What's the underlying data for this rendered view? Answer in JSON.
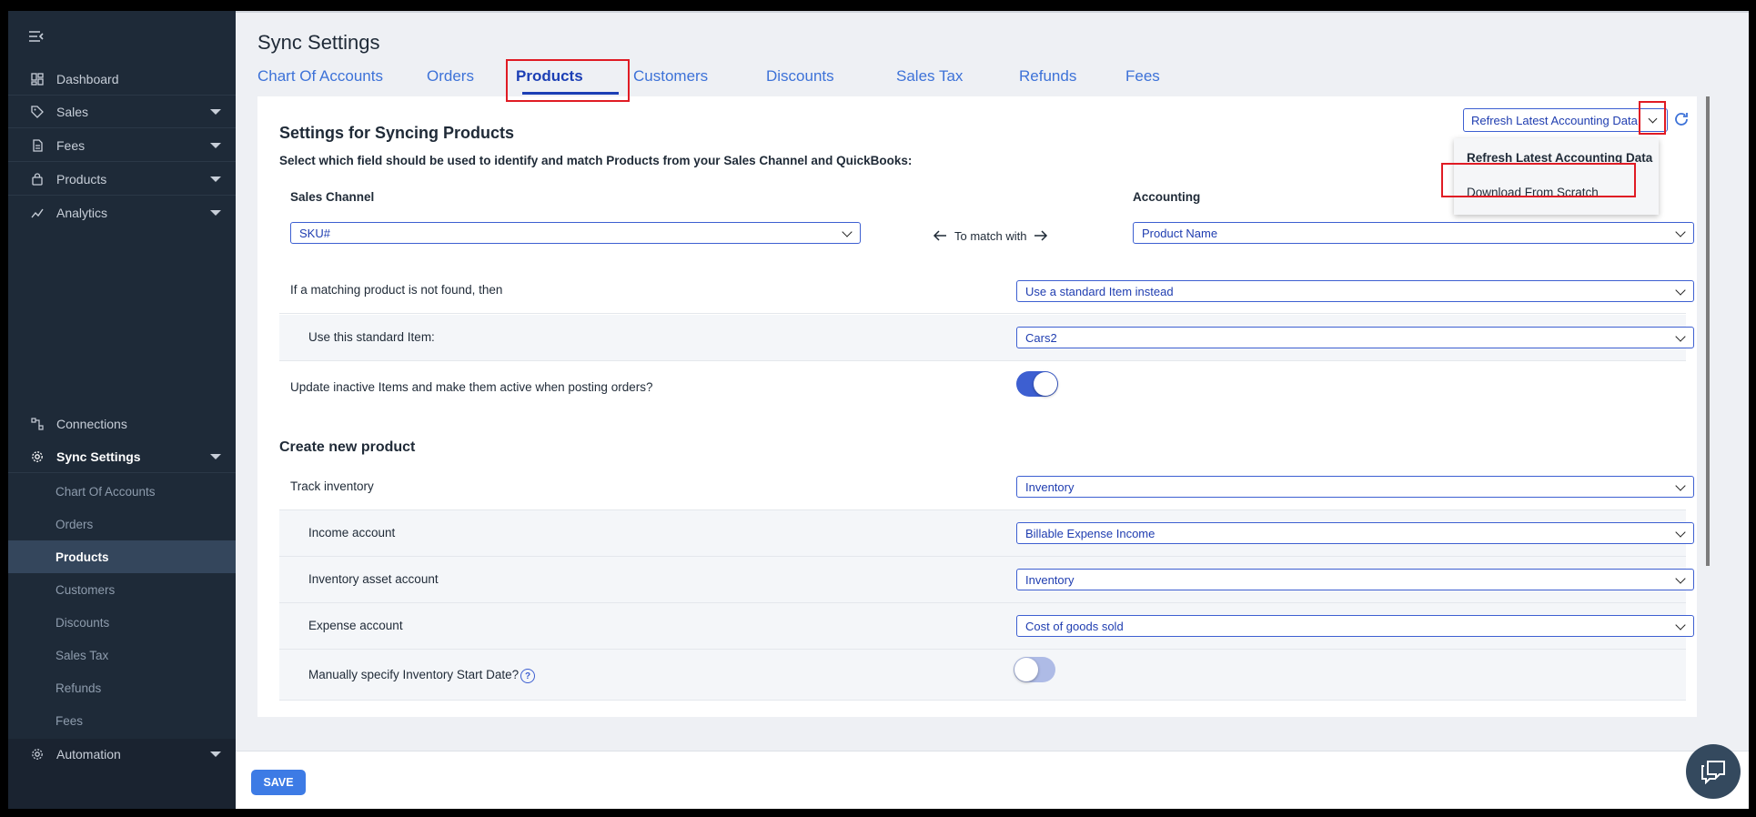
{
  "sidebar": {
    "items": [
      {
        "label": "Dashboard",
        "icon": "dashboard-icon"
      },
      {
        "label": "Sales",
        "icon": "tag-icon"
      },
      {
        "label": "Fees",
        "icon": "file-icon"
      },
      {
        "label": "Products",
        "icon": "lock-bag-icon"
      },
      {
        "label": "Analytics",
        "icon": "chart-line-icon"
      }
    ],
    "connections_label": "Connections",
    "sync_settings_label": "Sync Settings",
    "sub_items": [
      {
        "label": "Chart Of Accounts"
      },
      {
        "label": "Orders"
      },
      {
        "label": "Products"
      },
      {
        "label": "Customers"
      },
      {
        "label": "Discounts"
      },
      {
        "label": "Sales Tax"
      },
      {
        "label": "Refunds"
      },
      {
        "label": "Fees"
      }
    ],
    "automation_label": "Automation"
  },
  "page": {
    "title": "Sync Settings",
    "tabs": [
      {
        "label": "Chart Of Accounts"
      },
      {
        "label": "Orders"
      },
      {
        "label": "Products"
      },
      {
        "label": "Customers"
      },
      {
        "label": "Discounts"
      },
      {
        "label": "Sales Tax"
      },
      {
        "label": "Refunds"
      },
      {
        "label": "Fees"
      }
    ],
    "active_tab": "Products"
  },
  "settings": {
    "heading": "Settings for Syncing Products",
    "subheading": "Select which field should be used to identify and match Products from your Sales Channel and QuickBooks:",
    "sales_channel_label": "Sales Channel",
    "accounting_label": "Accounting",
    "sales_channel_value": "SKU#",
    "accounting_value": "Product Name",
    "match_text": "To match with",
    "not_found_label": "If a matching product is not found, then",
    "not_found_value": "Use a standard Item instead",
    "standard_item_label": "Use this standard Item:",
    "standard_item_value": "Cars2",
    "update_inactive_label": "Update inactive Items and make them active when posting orders?",
    "update_inactive_on": true
  },
  "create": {
    "heading": "Create new product",
    "track_inventory_label": "Track inventory",
    "track_inventory_value": "Inventory",
    "income_account_label": "Income account",
    "income_account_value": "Billable Expense Income",
    "inventory_asset_label": "Inventory asset account",
    "inventory_asset_value": "Inventory",
    "expense_account_label": "Expense account",
    "expense_account_value": "Cost of goods sold",
    "start_date_label": "Manually specify Inventory Start Date?",
    "start_date_on": false,
    "help_glyph": "?"
  },
  "refresh": {
    "selected": "Refresh Latest Accounting Data",
    "options": [
      {
        "label": "Refresh Latest Accounting Data"
      },
      {
        "label": "Download From Scratch"
      }
    ]
  },
  "footer": {
    "save_label": "SAVE"
  },
  "colors": {
    "sidebar_bg": "#1e2a38",
    "accent": "#3d5fd1",
    "highlight": "#e01b24",
    "save": "#3d7be5"
  }
}
